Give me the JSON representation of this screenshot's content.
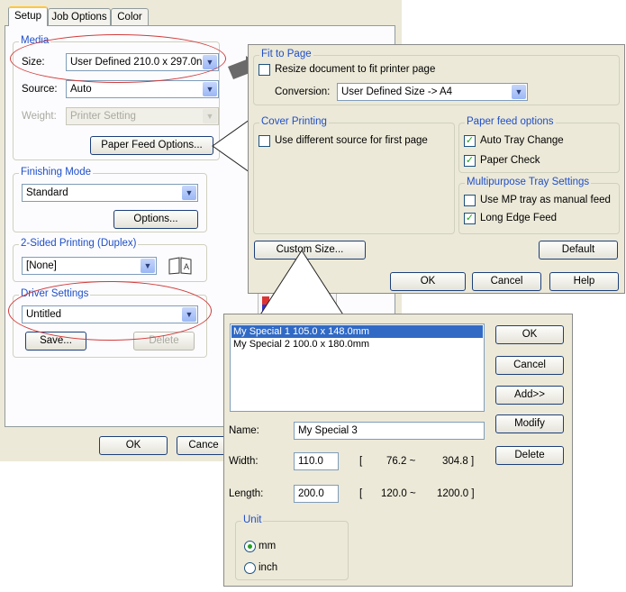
{
  "setup": {
    "tabs": [
      "Setup",
      "Job Options",
      "Color"
    ],
    "media_label": "Media",
    "size_label": "Size:",
    "size_value": "User Defined 210.0 x 297.0n",
    "source_label": "Source:",
    "source_value": "Auto",
    "weight_label": "Weight:",
    "weight_value": "Printer Setting",
    "paper_feed_btn": "Paper Feed Options...",
    "finishing_label": "Finishing Mode",
    "finishing_value": "Standard",
    "options_btn": "Options...",
    "duplex_label": "2-Sided Printing (Duplex)",
    "duplex_value": "[None]",
    "driver_label": "Driver Settings",
    "driver_value": "Untitled",
    "save_btn": "Save...",
    "delete_btn": "Delete",
    "ok_btn": "OK",
    "cancel_btn": "Cance"
  },
  "paper_feed": {
    "fit_label": "Fit to Page",
    "resize_label": "Resize document to fit printer page",
    "conversion_label": "Conversion:",
    "conversion_value": "User Defined Size -> A4",
    "cover_label": "Cover Printing",
    "cover_check_label": "Use different source for first page",
    "feed_label": "Paper feed options",
    "auto_tray_label": "Auto Tray Change",
    "paper_check_label": "Paper Check",
    "mp_label": "Multipurpose Tray Settings",
    "mp_manual_label": "Use MP tray as manual feed",
    "long_edge_label": "Long Edge Feed",
    "custom_size_btn": "Custom Size...",
    "default_btn": "Default",
    "ok_btn": "OK",
    "cancel_btn": "Cancel",
    "help_btn": "Help",
    "resize_checked": false,
    "cover_checked": false,
    "auto_tray_checked": true,
    "paper_check_checked": true,
    "mp_manual_checked": false,
    "long_edge_checked": true
  },
  "custom_size": {
    "list_items": [
      "My Special 1 105.0 x 148.0mm",
      "My Special 2 100.0 x 180.0mm"
    ],
    "ok_btn": "OK",
    "cancel_btn": "Cancel",
    "add_btn": "Add>>",
    "modify_btn": "Modify",
    "delete_btn": "Delete",
    "name_label": "Name:",
    "name_value": "My Special 3",
    "width_label": "Width:",
    "width_value": "110.0",
    "width_open": "[",
    "width_min": "76.2 ~",
    "width_max": "304.8 ]",
    "length_label": "Length:",
    "length_value": "200.0",
    "length_open": "[",
    "length_min": "120.0 ~",
    "length_max": "1200.0 ]",
    "unit_label": "Unit",
    "mm_label": "mm",
    "inch_label": "inch",
    "selected_unit": "mm"
  },
  "colors": {
    "accent_blue": "#1f4fc8",
    "highlight_oval": "#d23c3c",
    "check_green": "#21a121",
    "selection_blue": "#316ac5"
  }
}
